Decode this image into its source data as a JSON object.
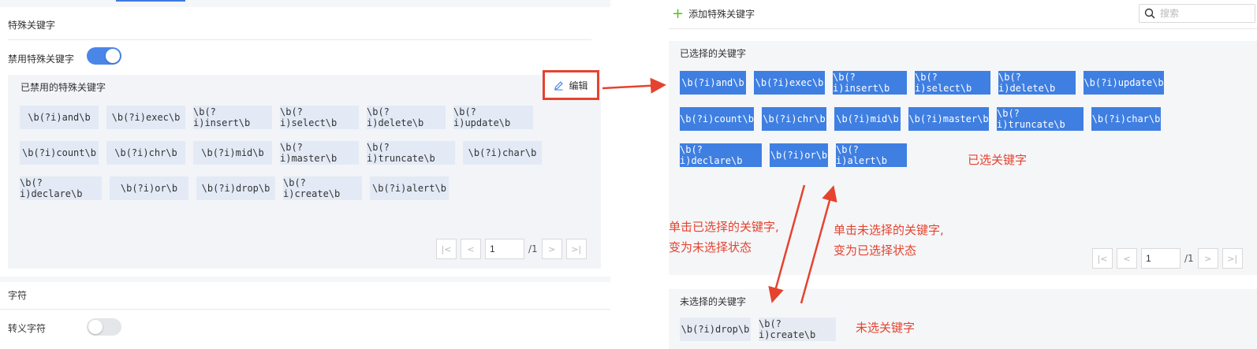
{
  "left": {
    "special_section_title": "特殊关键字",
    "disable_label": "禁用特殊关键字",
    "disabled_box_title": "已禁用的特殊关键字",
    "edit_label": "编辑",
    "keywords": [
      "\\b(?i)and\\b",
      "\\b(?i)exec\\b",
      "\\b(?i)insert\\b",
      "\\b(?i)select\\b",
      "\\b(?i)delete\\b",
      "\\b(?i)update\\b",
      "\\b(?i)count\\b",
      "\\b(?i)chr\\b",
      "\\b(?i)mid\\b",
      "\\b(?i)master\\b",
      "\\b(?i)truncate\\b",
      "\\b(?i)char\\b",
      "\\b(?i)declare\\b",
      "\\b(?i)or\\b",
      "\\b(?i)drop\\b",
      "\\b(?i)create\\b",
      "\\b(?i)alert\\b"
    ],
    "pager": {
      "page": "1",
      "total": "/1"
    },
    "char_section_title": "字符",
    "escape_label": "转义字符",
    "disable_toggle_on": true,
    "escape_toggle_on": false
  },
  "right": {
    "add_label": "添加特殊关键字",
    "search_placeholder": "搜索",
    "selected_title": "已选择的关键字",
    "selected_keywords": [
      "\\b(?i)and\\b",
      "\\b(?i)exec\\b",
      "\\b(?i)insert\\b",
      "\\b(?i)select\\b",
      "\\b(?i)delete\\b",
      "\\b(?i)update\\b",
      "\\b(?i)count\\b",
      "\\b(?i)chr\\b",
      "\\b(?i)mid\\b",
      "\\b(?i)master\\b",
      "\\b(?i)truncate\\b",
      "\\b(?i)char\\b",
      "\\b(?i)declare\\b",
      "\\b(?i)or\\b",
      "\\b(?i)alert\\b"
    ],
    "pager": {
      "page": "1",
      "total": "/1"
    },
    "unselected_title": "未选择的关键字",
    "unselected_keywords": [
      "\\b(?i)drop\\b",
      "\\b(?i)create\\b"
    ]
  },
  "annotations": {
    "selected_note": "已选关键字",
    "unselected_note": "未选关键字",
    "click_selected_line1": "单击已选择的关键字,",
    "click_selected_line2": "变为未选择状态",
    "click_unselected_line1": "单击未选择的关键字,",
    "click_unselected_line2": "变为已选择状态"
  },
  "colors": {
    "accent": "#3f7fe2",
    "annotation_red": "#e5432f",
    "add_plus_green": "#52c41a"
  }
}
